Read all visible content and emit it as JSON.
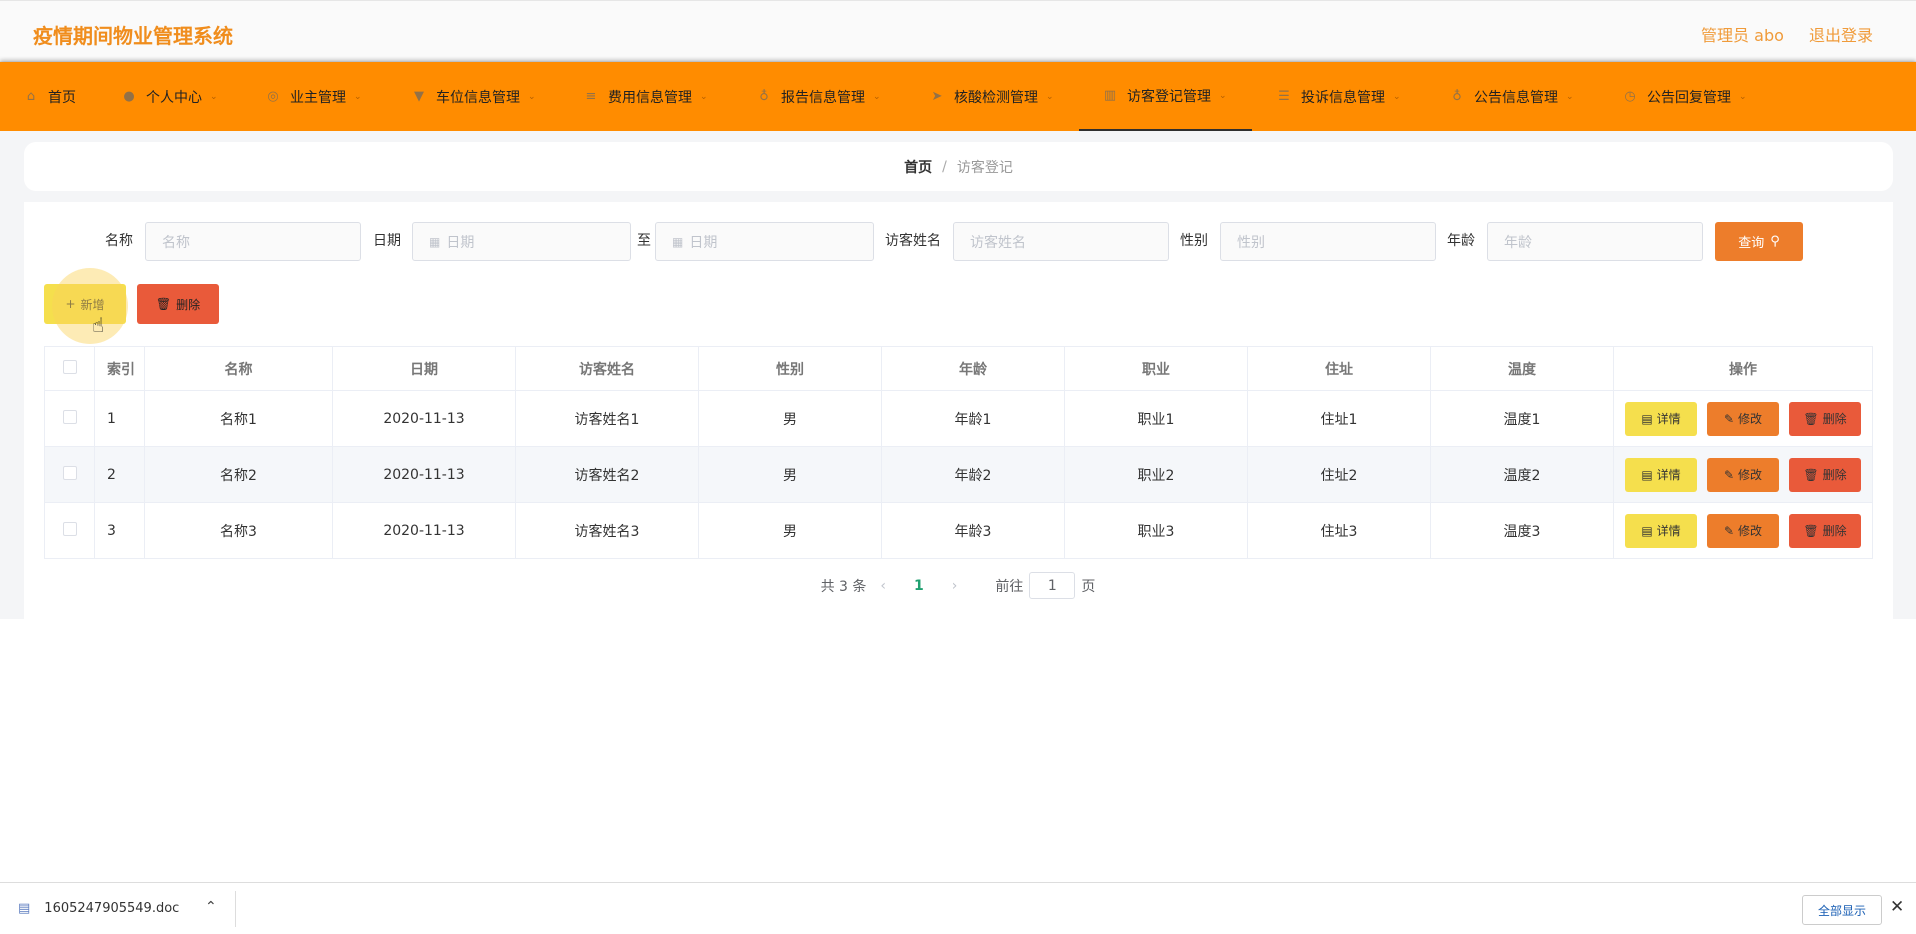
{
  "header": {
    "title": "疫情期间物业管理系统",
    "admin": "管理员 abo",
    "logout": "退出登录"
  },
  "nav": [
    {
      "label": "首页",
      "icon": "home-icon"
    },
    {
      "label": "个人中心",
      "icon": "user-icon"
    },
    {
      "label": "业主管理",
      "icon": "globe-icon"
    },
    {
      "label": "车位信息管理",
      "icon": "cup-icon"
    },
    {
      "label": "费用信息管理",
      "icon": "menu-icon"
    },
    {
      "label": "报告信息管理",
      "icon": "mic-icon"
    },
    {
      "label": "核酸检测管理",
      "icon": "send-icon"
    },
    {
      "label": "访客登记管理",
      "icon": "chart-icon"
    },
    {
      "label": "投诉信息管理",
      "icon": "list-icon"
    },
    {
      "label": "公告信息管理",
      "icon": "mic-icon"
    },
    {
      "label": "公告回复管理",
      "icon": "clock-icon"
    }
  ],
  "breadcrumb": {
    "home": "首页",
    "sep": "/",
    "current": "访客登记"
  },
  "filters": {
    "name_label": "名称",
    "name_placeholder": "名称",
    "date_label": "日期",
    "date_from_placeholder": "日期",
    "to": "至",
    "date_to_placeholder": "日期",
    "visitor_label": "访客姓名",
    "visitor_placeholder": "访客姓名",
    "gender_label": "性别",
    "gender_placeholder": "性别",
    "age_label": "年龄",
    "age_placeholder": "年龄",
    "query_button": "查询"
  },
  "actions": {
    "add": "新增",
    "delete": "删除"
  },
  "table": {
    "headers": [
      "索引",
      "名称",
      "日期",
      "访客姓名",
      "性别",
      "年龄",
      "职业",
      "住址",
      "温度",
      "操作"
    ],
    "rows": [
      [
        "1",
        "名称1",
        "2020-11-13",
        "访客姓名1",
        "男",
        "年龄1",
        "职业1",
        "住址1",
        "温度1"
      ],
      [
        "2",
        "名称2",
        "2020-11-13",
        "访客姓名2",
        "男",
        "年龄2",
        "职业2",
        "住址2",
        "温度2"
      ],
      [
        "3",
        "名称3",
        "2020-11-13",
        "访客姓名3",
        "男",
        "年龄3",
        "职业3",
        "住址3",
        "温度3"
      ]
    ],
    "row_actions": {
      "detail": "详情",
      "edit": "修改",
      "delete": "删除"
    }
  },
  "pagination": {
    "total": "共 3 条",
    "current": "1",
    "goto": "前往",
    "page_input": "1",
    "page_unit": "页"
  },
  "download_bar": {
    "file": "1605247905549.doc",
    "show_all": "全部显示"
  },
  "colors": {
    "nav": "#ff8c00",
    "title": "#f08d1d",
    "query": "#ed7d2b",
    "add": "#f5df4d",
    "delete": "#e95a3a"
  }
}
